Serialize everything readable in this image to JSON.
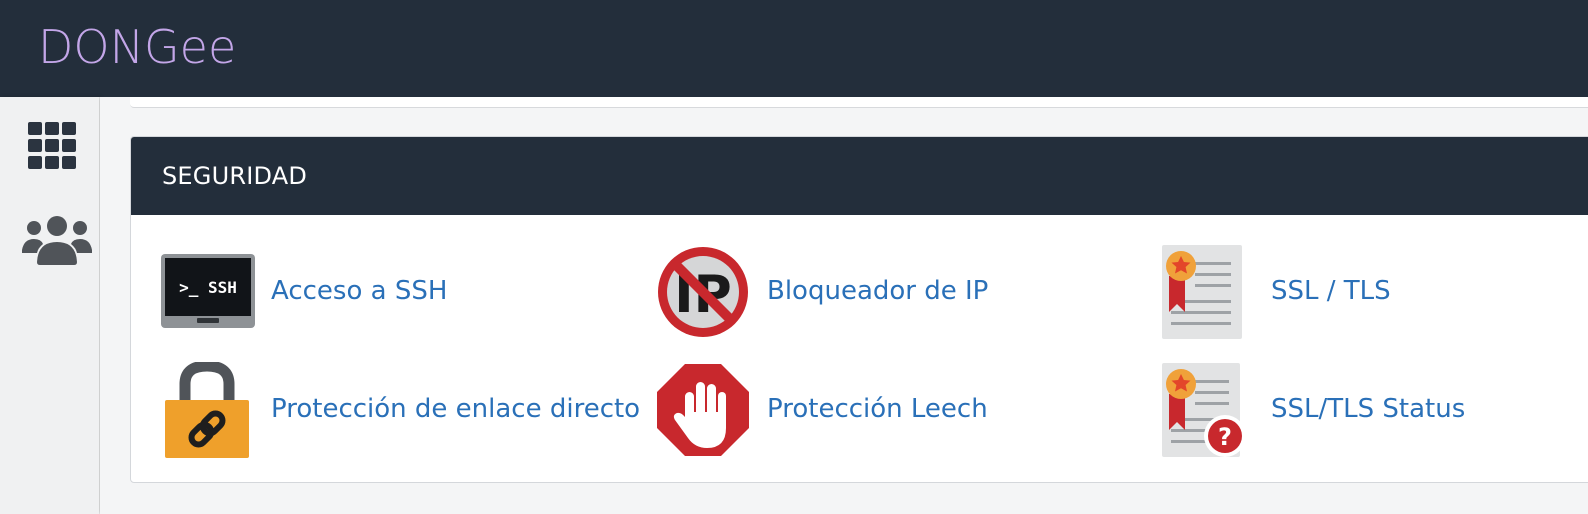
{
  "brand": {
    "logo_text": "DONGee"
  },
  "section": {
    "title": "SEGURIDAD"
  },
  "items": [
    {
      "label": "Acceso a SSH",
      "icon": "ssh-terminal-icon"
    },
    {
      "label": "Bloqueador de IP",
      "icon": "ip-blocker-icon"
    },
    {
      "label": "SSL / TLS",
      "icon": "ssl-certificate-icon"
    },
    {
      "label": "Protección de enlace directo",
      "icon": "hotlink-padlock-icon"
    },
    {
      "label": "Protección Leech",
      "icon": "leech-stop-hand-icon"
    },
    {
      "label": "SSL/TLS Status",
      "icon": "ssl-status-icon"
    }
  ],
  "icon_texts": {
    "ssh": ">_ SSH",
    "ip": "IP",
    "question": "?"
  },
  "colors": {
    "header_bg": "#232e3b",
    "logo": "#c3a6e8",
    "link": "#2a70b8",
    "danger": "#c8282d",
    "padlock": "#efa02b"
  }
}
